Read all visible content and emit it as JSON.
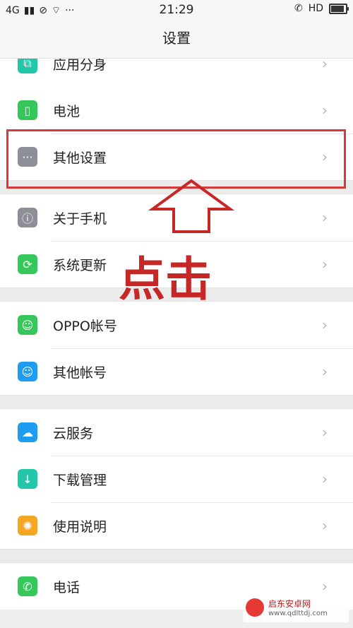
{
  "status": {
    "network": "4G",
    "time": "21:29",
    "right_badge": "HD",
    "battery": 0.8
  },
  "header": {
    "title": "设置"
  },
  "rows": [
    {
      "label": "应用分身",
      "icon": "app-clone-icon",
      "color": "#23c6a8"
    },
    {
      "label": "电池",
      "icon": "battery-icon",
      "color": "#35c759"
    },
    {
      "label": "其他设置",
      "icon": "more-dots-icon",
      "color": "#8c8f95"
    },
    {
      "label": "关于手机",
      "icon": "info-icon",
      "color": "#8c8f95"
    },
    {
      "label": "系统更新",
      "icon": "update-icon",
      "color": "#35c759"
    },
    {
      "label": "OPPO帐号",
      "icon": "user-icon",
      "color": "#35c759"
    },
    {
      "label": "其他帐号",
      "icon": "user-icon",
      "color": "#1e9df0"
    },
    {
      "label": "云服务",
      "icon": "cloud-icon",
      "color": "#1e9df0"
    },
    {
      "label": "下载管理",
      "icon": "download-icon",
      "color": "#23c6a8"
    },
    {
      "label": "使用说明",
      "icon": "bulb-icon",
      "color": "#f5a623"
    },
    {
      "label": "电话",
      "icon": "phone-icon",
      "color": "#35c759"
    }
  ],
  "annotation": {
    "text": "点击",
    "color": "#c62828"
  },
  "watermark": {
    "title": "启东安卓网",
    "url": "www.qdlttdj.com"
  }
}
